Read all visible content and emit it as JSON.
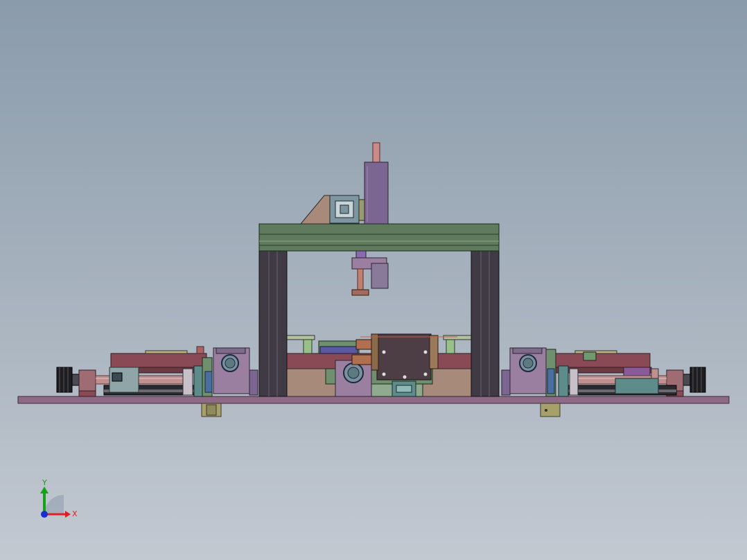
{
  "viewport": {
    "background_top": "#8a9bac",
    "background_bottom": "#c3c9d1"
  },
  "model": {
    "palette": {
      "base_plate": "#8f6a86",
      "frame_beam": "#5f7a5c",
      "frame_column": "#3f3a44",
      "cylinder": "#7a6690",
      "slide_red": "#8a4a55",
      "motor_box": "#9a7fa0",
      "rod_pink": "#c09090",
      "green_part": "#6f8f6f",
      "teal_part": "#5d8c8a",
      "dark_part": "#2a2a30",
      "center_block": "#4d3d44"
    }
  },
  "triad": {
    "x_label": "X",
    "y_label": "Y",
    "x_color": "#e02020",
    "y_color": "#18a018",
    "z_color": "#1a2fd0"
  }
}
